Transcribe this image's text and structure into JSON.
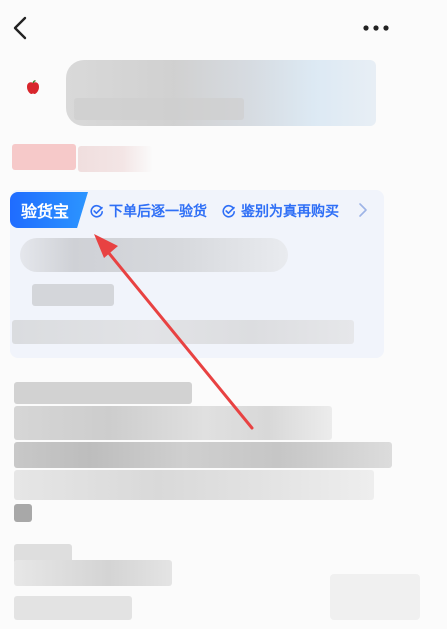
{
  "header": {
    "back_icon": "chevron-left-icon",
    "more_icon": "more-horizontal-icon"
  },
  "product": {
    "logo_icon": "apple-icon"
  },
  "verification": {
    "tag_label": "验货宝",
    "features": [
      {
        "icon": "check-circle-icon",
        "label": "下单后逐一验货"
      },
      {
        "icon": "check-circle-icon",
        "label": "鉴别为真再购买"
      }
    ],
    "more_icon": "chevron-right-icon"
  },
  "colors": {
    "accent_blue": "#2f6ff6",
    "tag_gradient_start": "#1f6cff",
    "arrow_red": "#e84242",
    "card_bg": "#f1f4fb"
  }
}
